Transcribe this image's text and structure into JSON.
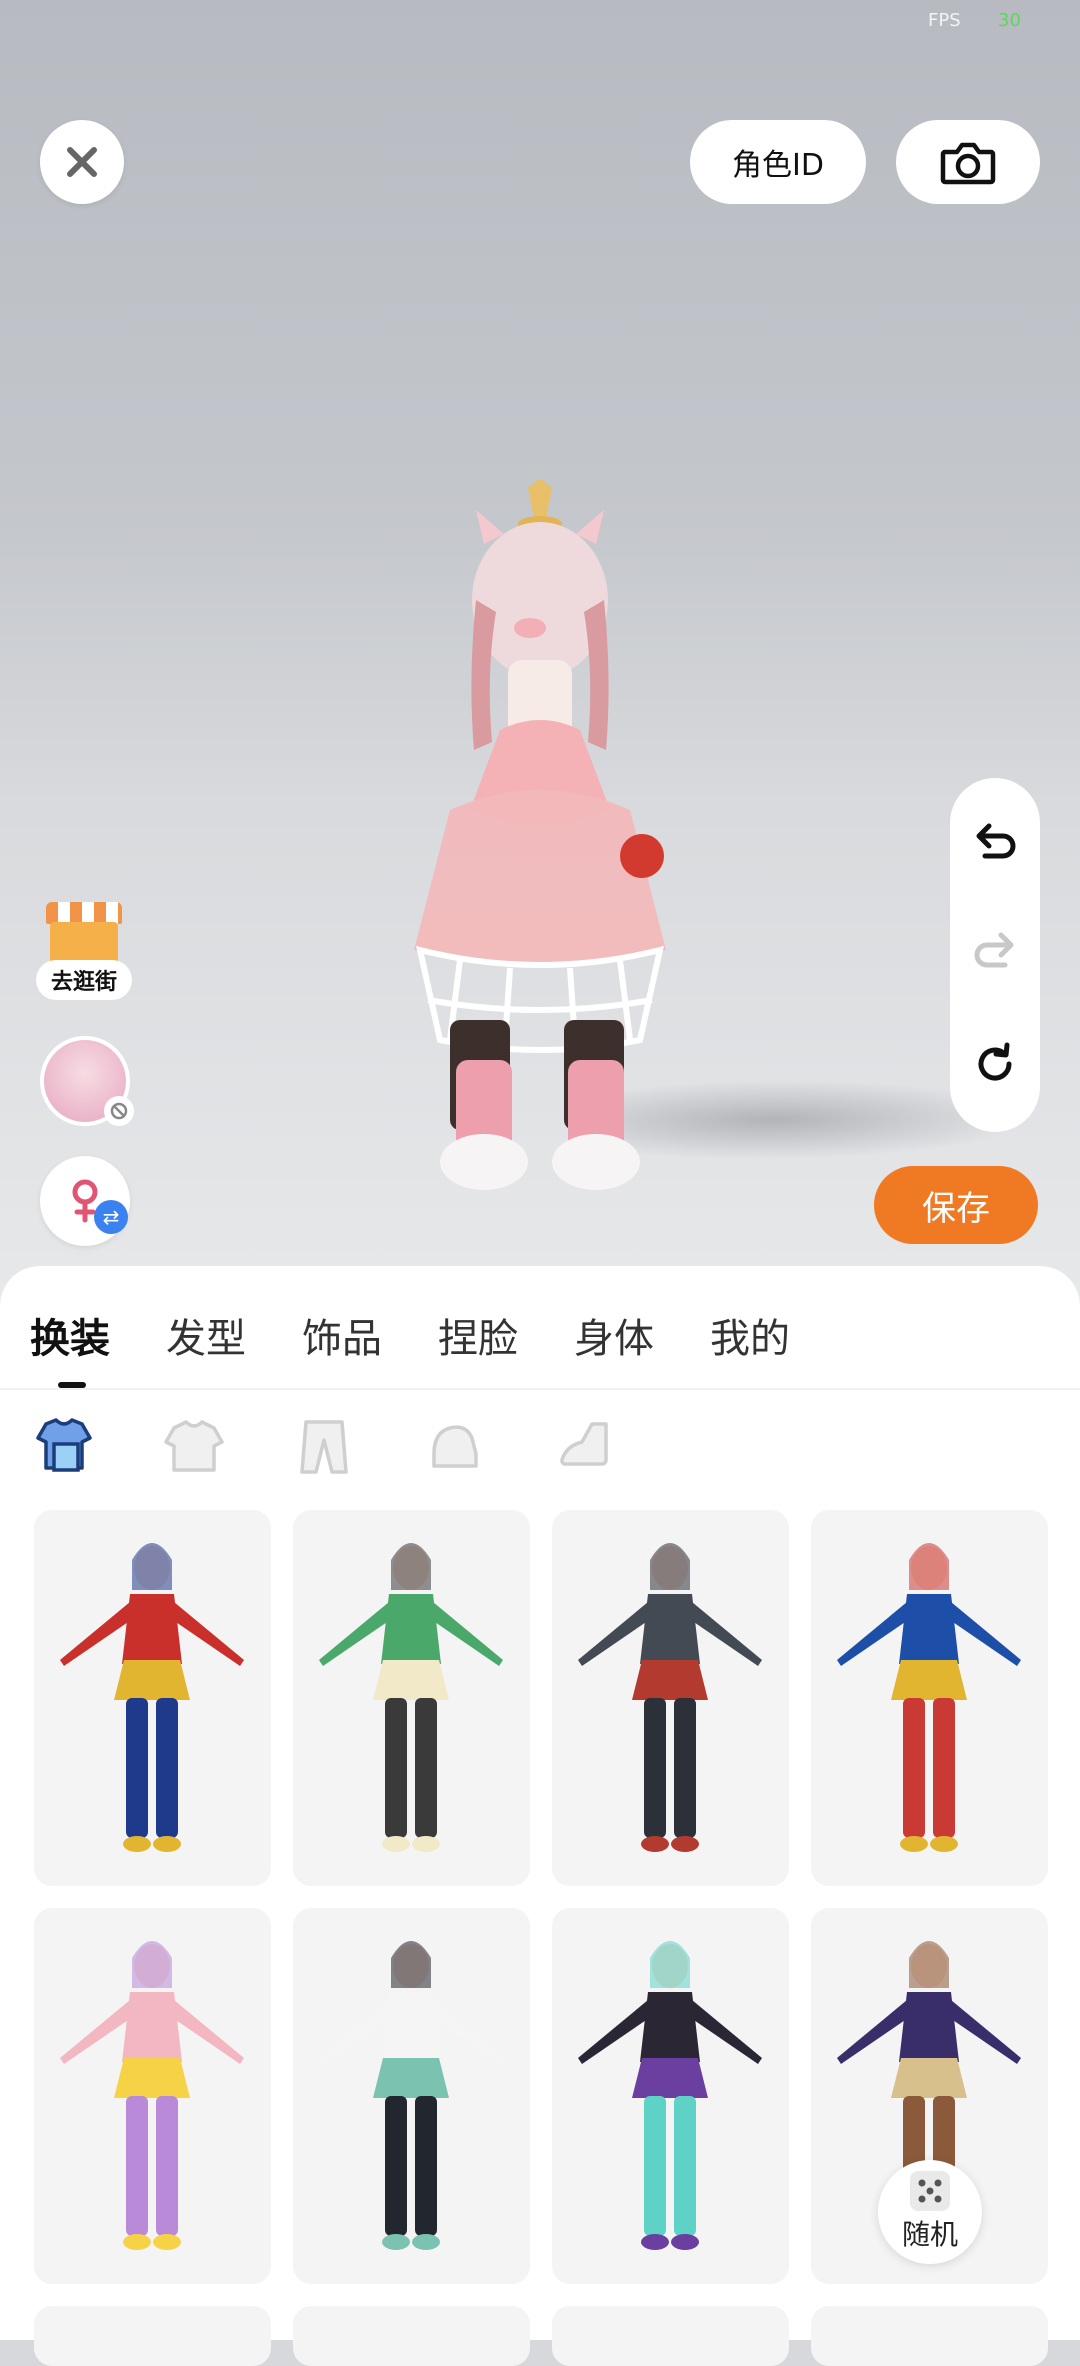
{
  "status": {
    "fps_label": "FPS",
    "fps_value": "30"
  },
  "top": {
    "role_id_label": "角色ID"
  },
  "side": {
    "shop_label": "去逛街"
  },
  "actions": {
    "save_label": "保存",
    "random_label": "随机"
  },
  "tabs": [
    {
      "label": "换装"
    },
    {
      "label": "发型"
    },
    {
      "label": "饰品"
    },
    {
      "label": "捏脸"
    },
    {
      "label": "身体"
    },
    {
      "label": "我的"
    }
  ],
  "subcategories": [
    {
      "icon": "outfit-icon"
    },
    {
      "icon": "top-icon"
    },
    {
      "icon": "pants-icon"
    },
    {
      "icon": "glove-icon"
    },
    {
      "icon": "shoe-icon"
    }
  ],
  "outfits": [
    {
      "icon": "wonder-hero-outfit",
      "colors": [
        "#c9302c",
        "#1f3a8a",
        "#e2b531"
      ]
    },
    {
      "icon": "green-kimono-outfit",
      "colors": [
        "#4aa96a",
        "#3a3a3a",
        "#f1e9c7"
      ]
    },
    {
      "icon": "black-tactical-suit",
      "colors": [
        "#444a54",
        "#2c3038",
        "#b23a2e"
      ]
    },
    {
      "icon": "red-blue-hero-suit",
      "colors": [
        "#1e4fa8",
        "#c93a34",
        "#e2b531"
      ]
    },
    {
      "icon": "pink-cat-costume",
      "colors": [
        "#f3b7c1",
        "#b88ad8",
        "#f6d247"
      ]
    },
    {
      "icon": "sport-tracksuit",
      "colors": [
        "#f5f5f5",
        "#22262e",
        "#7bc3b0"
      ]
    },
    {
      "icon": "gothic-dress",
      "colors": [
        "#2b2634",
        "#5fd2c7",
        "#6a3fa0"
      ]
    },
    {
      "icon": "wizard-robe",
      "colors": [
        "#3a2e6a",
        "#8a5a3a",
        "#d7c08b"
      ]
    }
  ]
}
